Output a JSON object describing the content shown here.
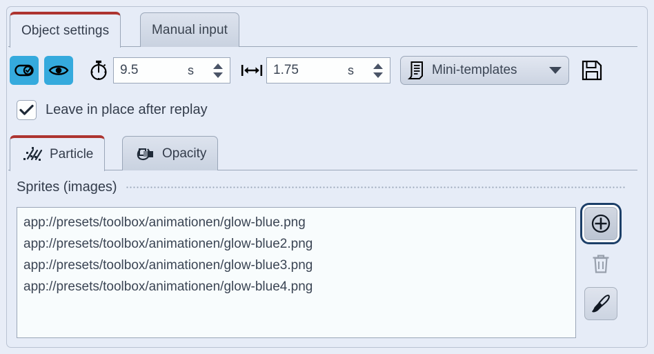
{
  "window": {
    "background_color": "#e8edf7",
    "accent_color": "#ad3430",
    "icon_button_color": "#35aadd",
    "focus_ring_color": "#1c3f68"
  },
  "tabs": {
    "items": [
      {
        "label": "Object settings",
        "active": true
      },
      {
        "label": "Manual input",
        "active": false
      }
    ]
  },
  "toolbar": {
    "toggle_button_icon": "toggle-check-icon",
    "visibility_button_icon": "eye-icon",
    "duration": {
      "icon": "stopwatch-icon",
      "value": "9.5",
      "unit": "s"
    },
    "distance": {
      "icon": "horizontal-arrows-icon",
      "value": "1.75",
      "unit": "s"
    },
    "templates": {
      "icon": "document-list-icon",
      "label": "Mini-templates",
      "caret": "chevron-down-icon"
    },
    "save_icon": "floppy-disk-icon"
  },
  "options": {
    "leave_in_place": {
      "label": "Leave in place after replay",
      "checked": true
    }
  },
  "subtabs": {
    "items": [
      {
        "label": "Particle",
        "icon": "particle-icon",
        "active": true
      },
      {
        "label": "Opacity",
        "icon": "opacity-icon",
        "active": false
      }
    ]
  },
  "sprites_section": {
    "title": "Sprites (images)",
    "items": [
      "app://presets/toolbox/animationen/glow-blue.png",
      "app://presets/toolbox/animationen/glow-blue2.png",
      "app://presets/toolbox/animationen/glow-blue3.png",
      "app://presets/toolbox/animationen/glow-blue4.png"
    ],
    "actions": [
      {
        "name": "add-sprite-button",
        "icon": "plus-circle-icon",
        "state": "focused"
      },
      {
        "name": "delete-sprite-button",
        "icon": "trash-icon",
        "state": "disabled"
      },
      {
        "name": "edit-sprite-button",
        "icon": "paintbrush-icon",
        "state": "enabled"
      }
    ]
  }
}
